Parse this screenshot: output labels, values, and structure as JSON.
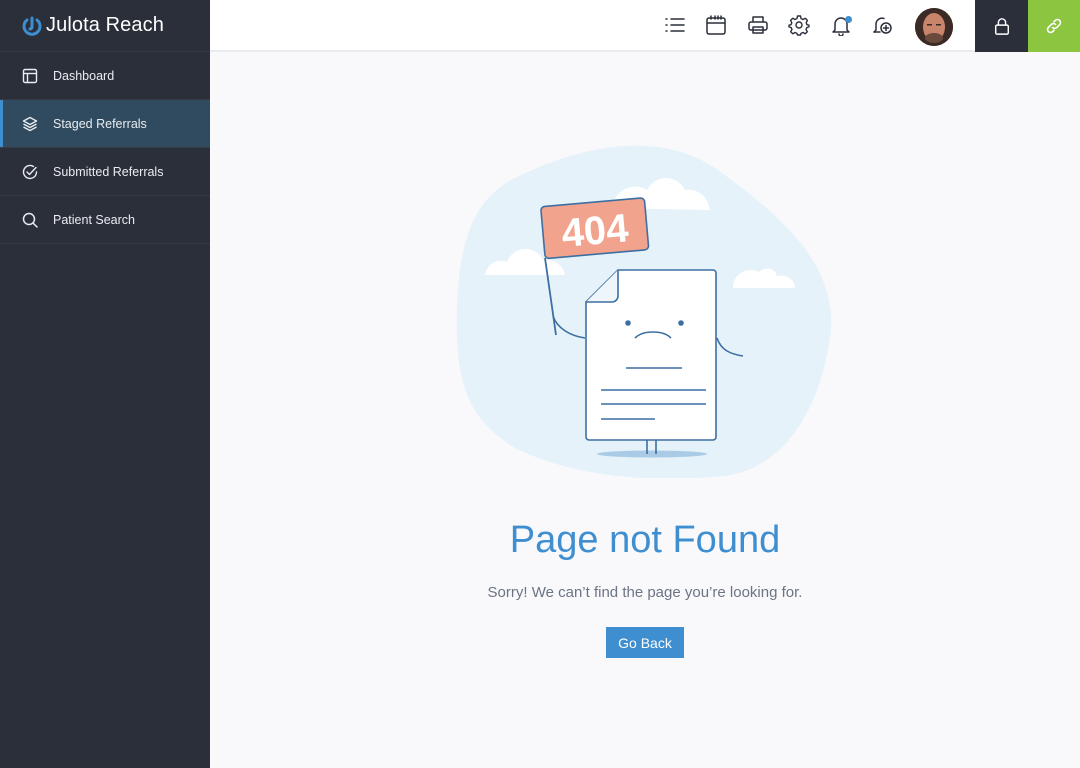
{
  "app": {
    "name": "Julota Reach"
  },
  "sidebar": {
    "items": [
      {
        "label": "Dashboard",
        "icon": "layout-icon",
        "active": false
      },
      {
        "label": "Staged Referrals",
        "icon": "layers-icon",
        "active": true
      },
      {
        "label": "Submitted Referrals",
        "icon": "check-circle-icon",
        "active": false
      },
      {
        "label": "Patient Search",
        "icon": "search-icon",
        "active": false
      }
    ]
  },
  "topbar": {
    "icons": [
      "list-icon",
      "calendar-icon",
      "printer-icon",
      "gear-icon",
      "bell-icon",
      "add-notification-icon"
    ],
    "notification_dot": true,
    "lock_icon": "lock-icon",
    "link_icon": "link-icon"
  },
  "colors": {
    "accent": "#3e8ed0",
    "sidebar_bg": "#2b2f3a",
    "active_item_bg": "#304b5f",
    "link_button": "#8cc540",
    "flag": "#f2a38e"
  },
  "main": {
    "flag_text": "404",
    "title": "Page not Found",
    "subtitle": "Sorry! We can’t find the page you’re looking for.",
    "button_label": "Go Back"
  }
}
